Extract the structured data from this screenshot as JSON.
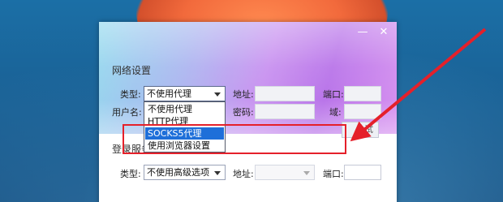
{
  "dialog": {
    "minimize_glyph": "—",
    "close_glyph": "✕"
  },
  "network": {
    "section_title": "网络设置",
    "type_label": "类型:",
    "type_value": "不使用代理",
    "address_label": "地址:",
    "port_label": "端口:",
    "username_label": "用户名:",
    "password_label": "密码:",
    "domain_label": "域:",
    "test_button": "试"
  },
  "dropdown": {
    "options": [
      "不使用代理",
      "HTTP代理",
      "SOCKS5代理",
      "使用浏览器设置"
    ],
    "selected_index": 2
  },
  "login_server": {
    "section_title": "登录服务",
    "type_label": "类型:",
    "type_value": "不使用高级选项",
    "address_label": "地址:",
    "port_label": "端口:"
  },
  "colors": {
    "highlight": "#e5202a",
    "selection": "#1e6fd9"
  }
}
